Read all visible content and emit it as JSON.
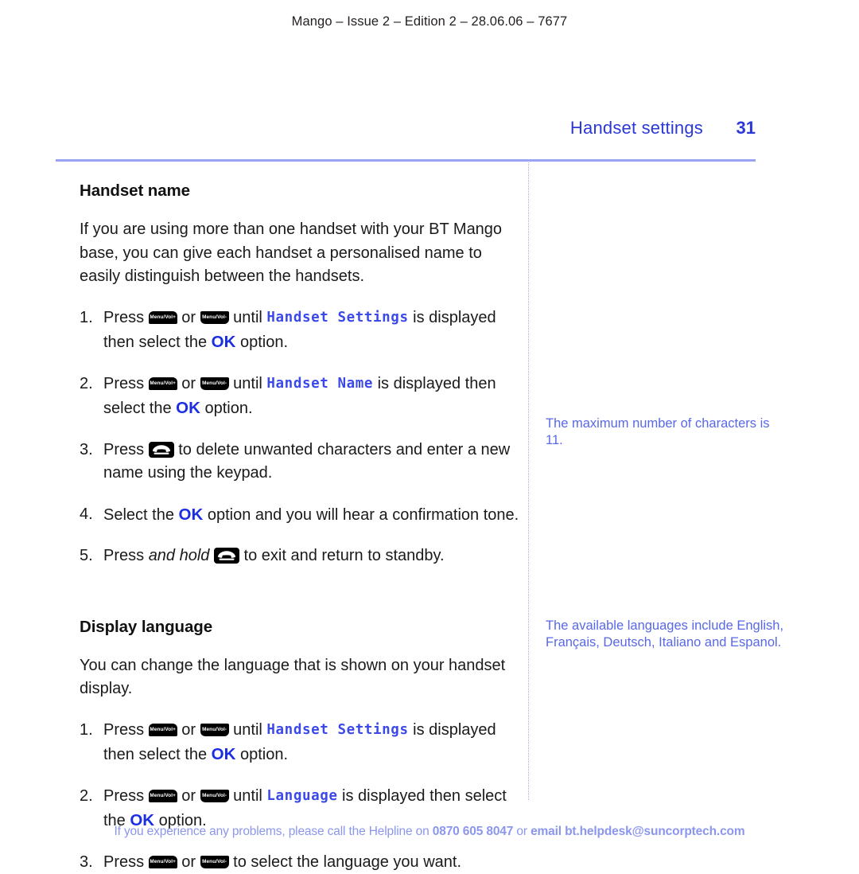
{
  "document": {
    "running_header": "Mango – Issue 2 – Edition 2 – 28.06.06 – 7677",
    "chapter_title": "Handset settings",
    "page_number": "31",
    "accent_blue": "#2b38d6",
    "rule_color": "#9aa3f2",
    "note_color": "#5968e6",
    "footer_color": "#8b96ee"
  },
  "icons": {
    "vol_up_label": "Menu/Vol+",
    "vol_down_label": "Menu/Vol-",
    "end_call_name": "end-call-handset-icon"
  },
  "sections": [
    {
      "heading": "Handset name",
      "intro": "If you are using more than one handset with your BT Mango base, you can give each handset a personalised name to easily distinguish between the handsets.",
      "steps": [
        {
          "number": "1.",
          "parts": [
            {
              "type": "text",
              "value": "Press "
            },
            {
              "type": "key",
              "key": "vol_up"
            },
            {
              "type": "text",
              "value": " or "
            },
            {
              "type": "key",
              "key": "vol_down"
            },
            {
              "type": "text",
              "value": " until "
            },
            {
              "type": "lcd",
              "value": "Handset Settings"
            },
            {
              "type": "text",
              "value": " is displayed then select the "
            },
            {
              "type": "ok",
              "value": "OK"
            },
            {
              "type": "text",
              "value": " option."
            }
          ]
        },
        {
          "number": "2.",
          "parts": [
            {
              "type": "text",
              "value": "Press "
            },
            {
              "type": "key",
              "key": "vol_up"
            },
            {
              "type": "text",
              "value": " or "
            },
            {
              "type": "key",
              "key": "vol_down"
            },
            {
              "type": "text",
              "value": " until "
            },
            {
              "type": "lcd",
              "value": "Handset Name"
            },
            {
              "type": "text",
              "value": " is displayed then select the "
            },
            {
              "type": "ok",
              "value": "OK"
            },
            {
              "type": "text",
              "value": " option."
            }
          ]
        },
        {
          "number": "3.",
          "parts": [
            {
              "type": "text",
              "value": "Press "
            },
            {
              "type": "key",
              "key": "end_call"
            },
            {
              "type": "text",
              "value": " to delete unwanted characters and enter a new name using the keypad."
            }
          ]
        },
        {
          "number": "4.",
          "parts": [
            {
              "type": "text",
              "value": "Select the "
            },
            {
              "type": "ok",
              "value": "OK"
            },
            {
              "type": "text",
              "value": " option and you will hear a confirmation tone."
            }
          ]
        },
        {
          "number": "5.",
          "parts": [
            {
              "type": "text",
              "value": "Press "
            },
            {
              "type": "italic",
              "value": "and hold"
            },
            {
              "type": "text",
              "value": " "
            },
            {
              "type": "key",
              "key": "end_call"
            },
            {
              "type": "text",
              "value": " to exit and return to standby."
            }
          ]
        }
      ]
    },
    {
      "heading": "Display language",
      "intro": "You can change the language that is shown on your handset display.",
      "steps": [
        {
          "number": "1.",
          "parts": [
            {
              "type": "text",
              "value": "Press "
            },
            {
              "type": "key",
              "key": "vol_up"
            },
            {
              "type": "text",
              "value": " or "
            },
            {
              "type": "key",
              "key": "vol_down"
            },
            {
              "type": "text",
              "value": " until "
            },
            {
              "type": "lcd",
              "value": "Handset Settings"
            },
            {
              "type": "text",
              "value": " is displayed then select the "
            },
            {
              "type": "ok",
              "value": "OK"
            },
            {
              "type": "text",
              "value": " option."
            }
          ]
        },
        {
          "number": "2.",
          "parts": [
            {
              "type": "text",
              "value": "Press "
            },
            {
              "type": "key",
              "key": "vol_up"
            },
            {
              "type": "text",
              "value": " or "
            },
            {
              "type": "key",
              "key": "vol_down"
            },
            {
              "type": "text",
              "value": " until "
            },
            {
              "type": "lcd",
              "value": "Language"
            },
            {
              "type": "text",
              "value": " is displayed then select the "
            },
            {
              "type": "ok",
              "value": "OK"
            },
            {
              "type": "text",
              "value": " option."
            }
          ]
        },
        {
          "number": "3.",
          "parts": [
            {
              "type": "text",
              "value": "Press "
            },
            {
              "type": "key",
              "key": "vol_up"
            },
            {
              "type": "text",
              "value": " or "
            },
            {
              "type": "key",
              "key": "vol_down"
            },
            {
              "type": "text",
              "value": " to select the language you want."
            }
          ]
        }
      ]
    }
  ],
  "side_notes": [
    {
      "text": "The maximum number of characters is 11."
    },
    {
      "text": "The available languages include English, Français, Deutsch, Italiano and Espanol."
    }
  ],
  "footer": {
    "lead": "If you experience any problems, please call the Helpline on ",
    "phone": "0870 605 8047",
    "middle": " or ",
    "email": "email bt.helpdesk@suncorptech.com"
  }
}
